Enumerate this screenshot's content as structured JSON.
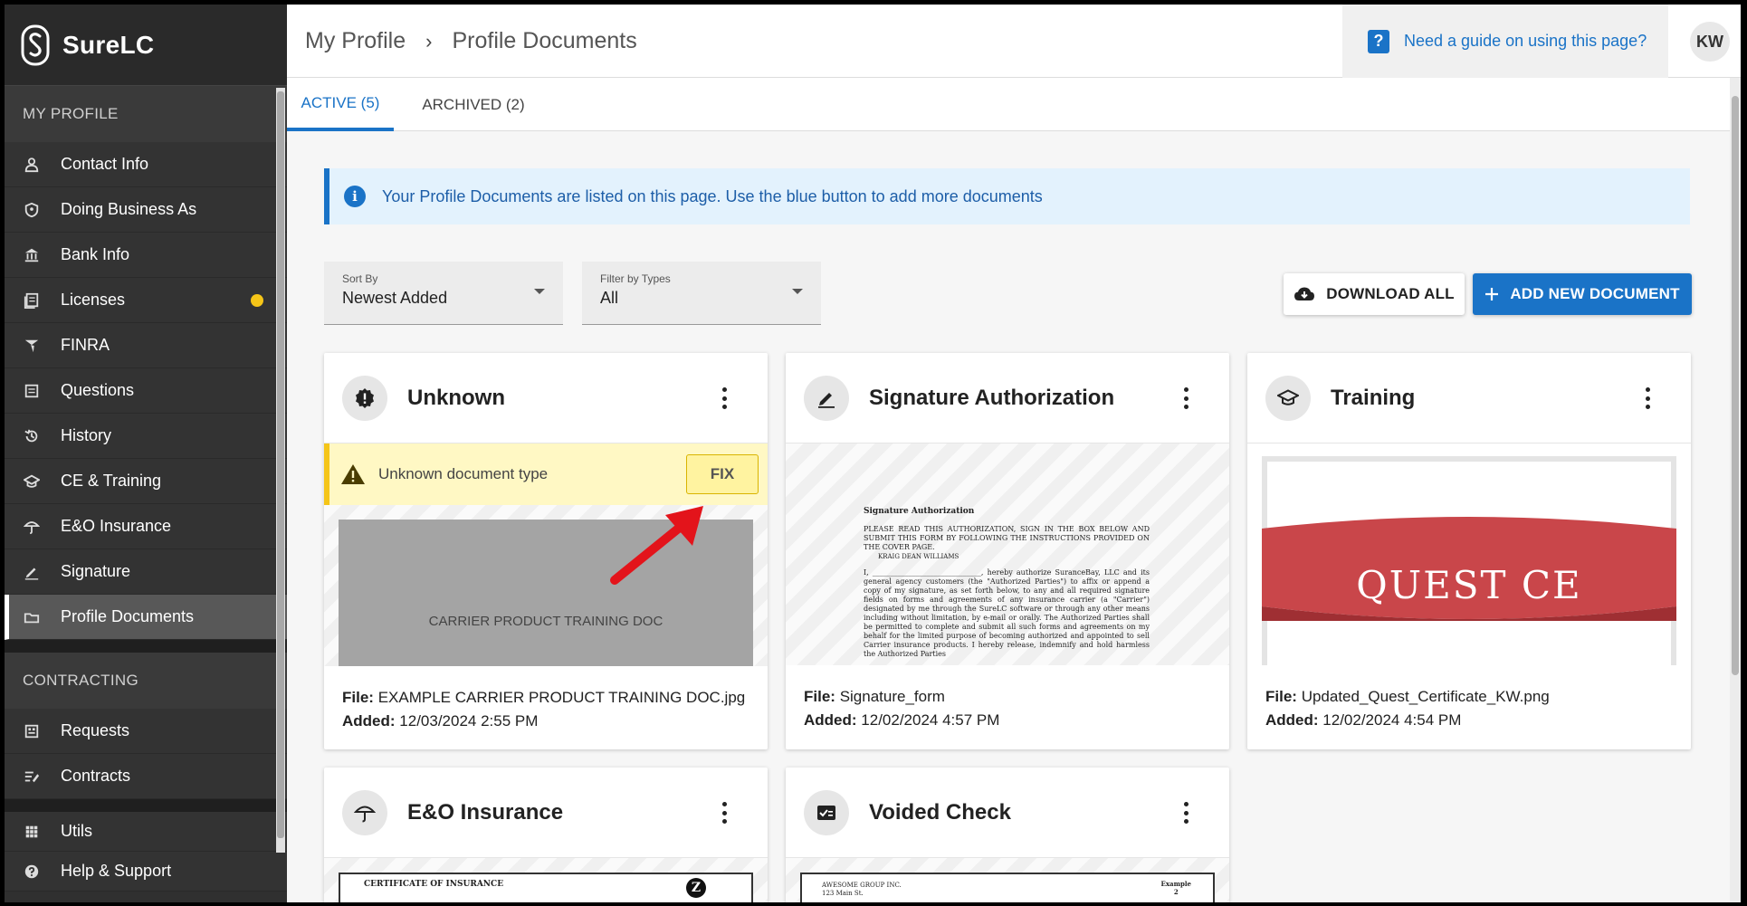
{
  "app": {
    "name": "SureLC"
  },
  "sidebar": {
    "sections": [
      {
        "title": "MY PROFILE"
      },
      {
        "title": "CONTRACTING"
      }
    ],
    "profile_items": [
      {
        "label": "Contact Info",
        "icon": "person-icon"
      },
      {
        "label": "Doing Business As",
        "icon": "shield-icon"
      },
      {
        "label": "Bank Info",
        "icon": "bank-icon"
      },
      {
        "label": "Licenses",
        "icon": "license-icon",
        "badge_color": "#f5c518"
      },
      {
        "label": "FINRA",
        "icon": "finra-icon"
      },
      {
        "label": "Questions",
        "icon": "questions-icon"
      },
      {
        "label": "History",
        "icon": "history-icon"
      },
      {
        "label": "CE & Training",
        "icon": "graduation-cap-icon"
      },
      {
        "label": "E&O Insurance",
        "icon": "umbrella-icon"
      },
      {
        "label": "Signature",
        "icon": "pen-icon"
      },
      {
        "label": "Profile Documents",
        "icon": "documents-icon",
        "active": true
      }
    ],
    "contracting_items": [
      {
        "label": "Requests",
        "icon": "requests-icon"
      },
      {
        "label": "Contracts",
        "icon": "contracts-icon"
      }
    ],
    "bottom_items": [
      {
        "label": "Utils",
        "icon": "grid-icon"
      },
      {
        "label": "Help & Support",
        "icon": "help-icon"
      }
    ]
  },
  "header": {
    "breadcrumb": [
      "My Profile",
      "Profile Documents"
    ],
    "guide_link": "Need a guide on using this page?",
    "avatar_initials": "KW"
  },
  "tabs": [
    {
      "label": "ACTIVE (5)",
      "active": true
    },
    {
      "label": "ARCHIVED (2)",
      "active": false
    }
  ],
  "info_banner": "Your Profile Documents are listed on this page. Use the blue button to add more documents",
  "sort": {
    "label": "Sort By",
    "value": "Newest Added"
  },
  "filter": {
    "label": "Filter by Types",
    "value": "All"
  },
  "buttons": {
    "download_all": "DOWNLOAD ALL",
    "add_new": "ADD NEW DOCUMENT"
  },
  "colors": {
    "accent": "#1a73c7",
    "warning": "#f5c518",
    "warning_bg": "#fff8c4",
    "quest_red": "#c9464a"
  },
  "cards": [
    {
      "title": "Unknown",
      "icon": "alert-badge-icon",
      "warning": "Unknown document type",
      "fix_label": "FIX",
      "preview_text": "CARRIER PRODUCT TRAINING DOC",
      "file_label": "File:",
      "file": "EXAMPLE CARRIER PRODUCT TRAINING DOC.jpg",
      "added_label": "Added:",
      "added": "12/03/2024 2:55 PM"
    },
    {
      "title": "Signature Authorization",
      "icon": "pen-icon",
      "preview_heading": "Signature Authorization",
      "preview_p1": "PLEASE READ THIS AUTHORIZATION, SIGN IN THE BOX BELOW AND SUBMIT THIS FORM BY FOLLOWING THE INSTRUCTIONS PROVIDED ON THE COVER PAGE.",
      "preview_name": "KRAIG DEAN WILLIAMS",
      "preview_p2": "I, ______________________________, hereby authorize SuranceBay, LLC and its general agency customers (the \"Authorized Parties\") to affix or append a copy of my signature, as set forth below, to any and all required signature fields on forms and agreements of any insurance carrier (a \"Carrier\") designated by me through the SureLC software or through any other means including without limitation, by e-mail or orally. The Authorized Parties shall be permitted to complete and submit all such forms and agreements on my behalf for the limited purpose of becoming authorized and appointed to sell Carrier insurance products. I hereby release, indemnify and hold harmless the Authorized Parties",
      "file_label": "File:",
      "file": "Signature_form",
      "added_label": "Added:",
      "added": "12/02/2024 4:57 PM"
    },
    {
      "title": "Training",
      "icon": "graduation-cap-icon",
      "preview_text": "QUEST CE",
      "file_label": "File:",
      "file": "Updated_Quest_Certificate_KW.png",
      "added_label": "Added:",
      "added": "12/02/2024 4:54 PM"
    },
    {
      "title": "E&O Insurance",
      "icon": "umbrella-icon",
      "preview_text": "CERTIFICATE OF INSURANCE"
    },
    {
      "title": "Voided Check",
      "icon": "check-icon",
      "preview_text": "AWESOME GROUP INC.",
      "preview_sub": "123 Main St.",
      "preview_corner": "Example",
      "preview_corner_num": "2"
    }
  ]
}
